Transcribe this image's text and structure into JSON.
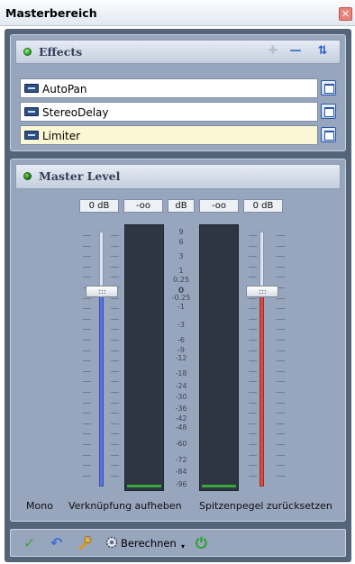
{
  "window": {
    "title": "Masterbereich",
    "close_glyph": "✕"
  },
  "effects": {
    "title": "Effects",
    "add_icon": "✚",
    "remove_icon": "—",
    "order_icon": "⇅",
    "items": [
      {
        "name": "AutoPan",
        "selected": false
      },
      {
        "name": "StereoDelay",
        "selected": false
      },
      {
        "name": "Limiter",
        "selected": true
      }
    ]
  },
  "master_level": {
    "title": "Master Level",
    "readouts": {
      "left_gain": "0 dB",
      "left_peak": "-oo",
      "unit": "dB",
      "right_peak": "-oo",
      "right_gain": "0 dB"
    },
    "scale": [
      "9",
      "6",
      "3",
      "1",
      "0.25",
      "0",
      "-0.25",
      "-1",
      "-3",
      "-6",
      "-9",
      "-12",
      "-18",
      "-24",
      "-30",
      "-36",
      "-42",
      "-48",
      "-60",
      "-72",
      "-84",
      "-96"
    ],
    "left_fader_level_db": 0,
    "right_fader_level_db": 0,
    "colors": {
      "left_channel": "#5a73e4",
      "right_channel": "#d84a45",
      "meter_base": "#3aa53a"
    },
    "mono_label": "Mono",
    "unlink_label": "Verknüpfung aufheben",
    "reset_peaks_label": "Spitzenpegel zurücksetzen"
  },
  "toolbar": {
    "apply_icon": "✓",
    "undo_icon": "↶",
    "settings_icon": "wrench-icon",
    "compute_icon": "gear-icon",
    "compute_label": "Berechnen",
    "power_icon": "⏻"
  }
}
